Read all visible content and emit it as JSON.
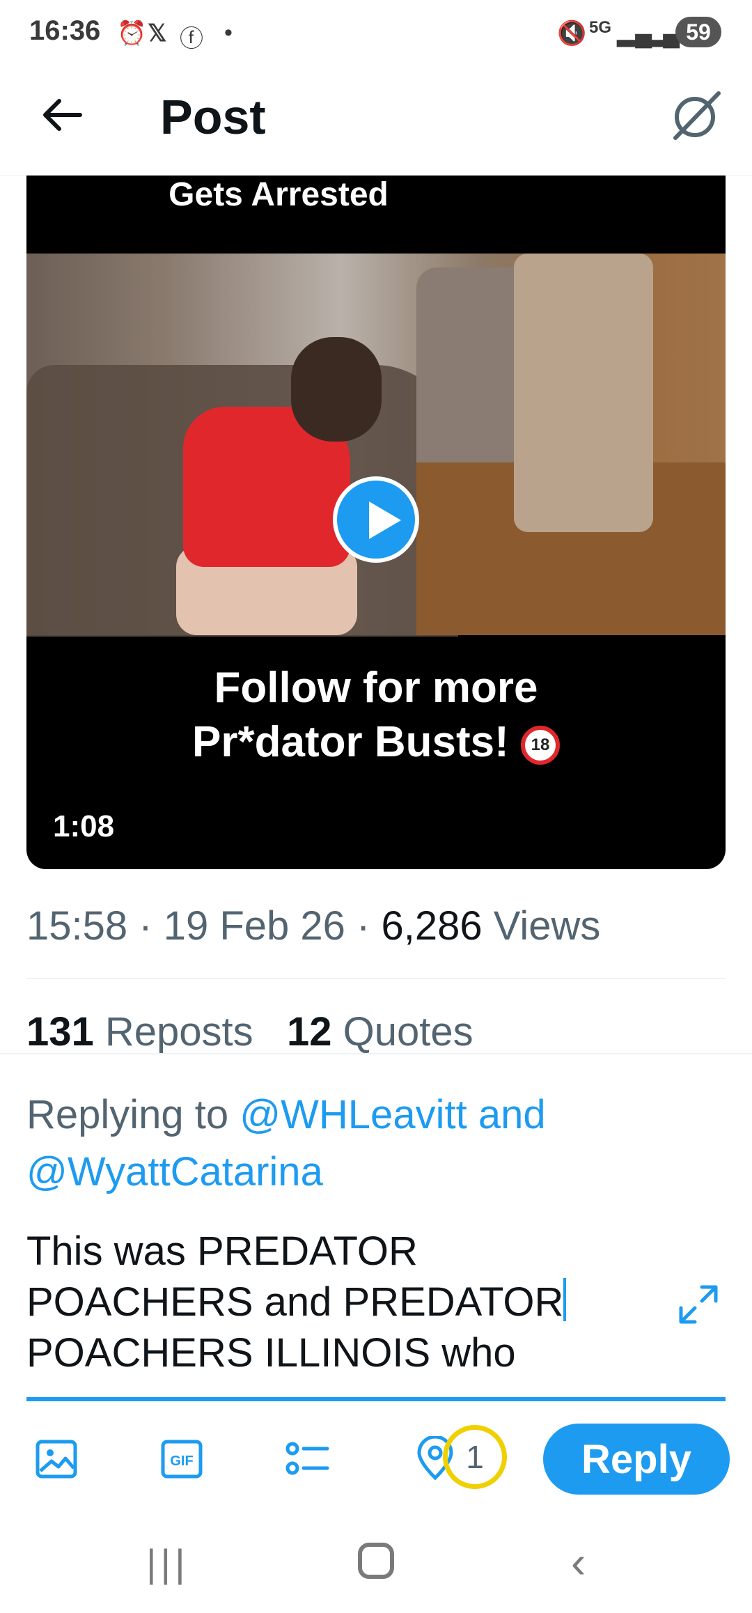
{
  "status_bar": {
    "time": "16:36",
    "icons": [
      "alarm-icon",
      "x-icon",
      "facebook-icon",
      "dot-icon",
      "mute-icon",
      "5g-icon",
      "signal-icon",
      "signal-icon"
    ],
    "battery": "59"
  },
  "header": {
    "title": "Post"
  },
  "media": {
    "top_caption": "Gets Arrested",
    "caption_line1": "Follow for more",
    "caption_line2": "Pr*dator Busts!",
    "badge": "18",
    "duration": "1:08"
  },
  "meta": {
    "time": "15:58",
    "sep1": " · ",
    "date": "19 Feb 26",
    "sep2": " · ",
    "views_count": "6,286",
    "views_label": " Views"
  },
  "stats": {
    "reposts_count": "131",
    "reposts_label": " Reposts",
    "quotes_count": "12",
    "quotes_label": " Quotes"
  },
  "reply": {
    "replying_prefix": "Replying to ",
    "mention1": "@WHLeavitt",
    "connector": " and",
    "mention2": "@WyattCatarina",
    "text_line1": "This was PREDATOR",
    "text_line2": "POACHERS and PREDATOR",
    "text_line3": "POACHERS ILLINOIS who"
  },
  "toolbar": {
    "counter": "1",
    "reply_label": "Reply"
  },
  "colors": {
    "accent": "#1d9bf0",
    "counter_ring": "#f0d000",
    "secondary_text": "#536471"
  }
}
